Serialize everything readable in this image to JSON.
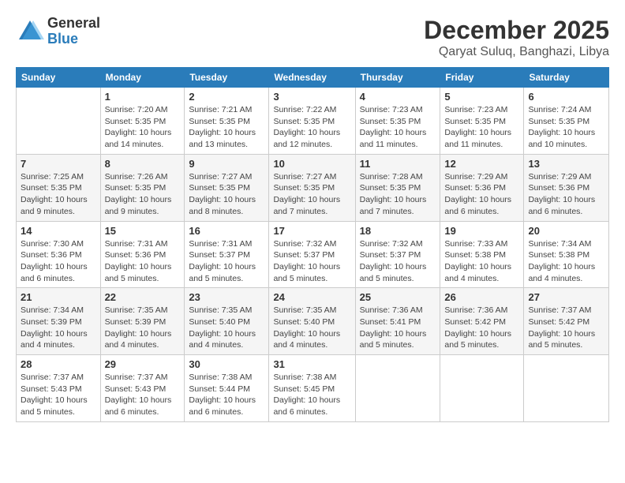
{
  "header": {
    "logo": {
      "general": "General",
      "blue": "Blue"
    },
    "title": "December 2025",
    "location": "Qaryat Suluq, Banghazi, Libya"
  },
  "days_of_week": [
    "Sunday",
    "Monday",
    "Tuesday",
    "Wednesday",
    "Thursday",
    "Friday",
    "Saturday"
  ],
  "weeks": [
    [
      {
        "day": "",
        "sunrise": "",
        "sunset": "",
        "daylight": ""
      },
      {
        "day": "1",
        "sunrise": "Sunrise: 7:20 AM",
        "sunset": "Sunset: 5:35 PM",
        "daylight": "Daylight: 10 hours and 14 minutes."
      },
      {
        "day": "2",
        "sunrise": "Sunrise: 7:21 AM",
        "sunset": "Sunset: 5:35 PM",
        "daylight": "Daylight: 10 hours and 13 minutes."
      },
      {
        "day": "3",
        "sunrise": "Sunrise: 7:22 AM",
        "sunset": "Sunset: 5:35 PM",
        "daylight": "Daylight: 10 hours and 12 minutes."
      },
      {
        "day": "4",
        "sunrise": "Sunrise: 7:23 AM",
        "sunset": "Sunset: 5:35 PM",
        "daylight": "Daylight: 10 hours and 11 minutes."
      },
      {
        "day": "5",
        "sunrise": "Sunrise: 7:23 AM",
        "sunset": "Sunset: 5:35 PM",
        "daylight": "Daylight: 10 hours and 11 minutes."
      },
      {
        "day": "6",
        "sunrise": "Sunrise: 7:24 AM",
        "sunset": "Sunset: 5:35 PM",
        "daylight": "Daylight: 10 hours and 10 minutes."
      }
    ],
    [
      {
        "day": "7",
        "sunrise": "Sunrise: 7:25 AM",
        "sunset": "Sunset: 5:35 PM",
        "daylight": "Daylight: 10 hours and 9 minutes."
      },
      {
        "day": "8",
        "sunrise": "Sunrise: 7:26 AM",
        "sunset": "Sunset: 5:35 PM",
        "daylight": "Daylight: 10 hours and 9 minutes."
      },
      {
        "day": "9",
        "sunrise": "Sunrise: 7:27 AM",
        "sunset": "Sunset: 5:35 PM",
        "daylight": "Daylight: 10 hours and 8 minutes."
      },
      {
        "day": "10",
        "sunrise": "Sunrise: 7:27 AM",
        "sunset": "Sunset: 5:35 PM",
        "daylight": "Daylight: 10 hours and 7 minutes."
      },
      {
        "day": "11",
        "sunrise": "Sunrise: 7:28 AM",
        "sunset": "Sunset: 5:35 PM",
        "daylight": "Daylight: 10 hours and 7 minutes."
      },
      {
        "day": "12",
        "sunrise": "Sunrise: 7:29 AM",
        "sunset": "Sunset: 5:36 PM",
        "daylight": "Daylight: 10 hours and 6 minutes."
      },
      {
        "day": "13",
        "sunrise": "Sunrise: 7:29 AM",
        "sunset": "Sunset: 5:36 PM",
        "daylight": "Daylight: 10 hours and 6 minutes."
      }
    ],
    [
      {
        "day": "14",
        "sunrise": "Sunrise: 7:30 AM",
        "sunset": "Sunset: 5:36 PM",
        "daylight": "Daylight: 10 hours and 6 minutes."
      },
      {
        "day": "15",
        "sunrise": "Sunrise: 7:31 AM",
        "sunset": "Sunset: 5:36 PM",
        "daylight": "Daylight: 10 hours and 5 minutes."
      },
      {
        "day": "16",
        "sunrise": "Sunrise: 7:31 AM",
        "sunset": "Sunset: 5:37 PM",
        "daylight": "Daylight: 10 hours and 5 minutes."
      },
      {
        "day": "17",
        "sunrise": "Sunrise: 7:32 AM",
        "sunset": "Sunset: 5:37 PM",
        "daylight": "Daylight: 10 hours and 5 minutes."
      },
      {
        "day": "18",
        "sunrise": "Sunrise: 7:32 AM",
        "sunset": "Sunset: 5:37 PM",
        "daylight": "Daylight: 10 hours and 5 minutes."
      },
      {
        "day": "19",
        "sunrise": "Sunrise: 7:33 AM",
        "sunset": "Sunset: 5:38 PM",
        "daylight": "Daylight: 10 hours and 4 minutes."
      },
      {
        "day": "20",
        "sunrise": "Sunrise: 7:34 AM",
        "sunset": "Sunset: 5:38 PM",
        "daylight": "Daylight: 10 hours and 4 minutes."
      }
    ],
    [
      {
        "day": "21",
        "sunrise": "Sunrise: 7:34 AM",
        "sunset": "Sunset: 5:39 PM",
        "daylight": "Daylight: 10 hours and 4 minutes."
      },
      {
        "day": "22",
        "sunrise": "Sunrise: 7:35 AM",
        "sunset": "Sunset: 5:39 PM",
        "daylight": "Daylight: 10 hours and 4 minutes."
      },
      {
        "day": "23",
        "sunrise": "Sunrise: 7:35 AM",
        "sunset": "Sunset: 5:40 PM",
        "daylight": "Daylight: 10 hours and 4 minutes."
      },
      {
        "day": "24",
        "sunrise": "Sunrise: 7:35 AM",
        "sunset": "Sunset: 5:40 PM",
        "daylight": "Daylight: 10 hours and 4 minutes."
      },
      {
        "day": "25",
        "sunrise": "Sunrise: 7:36 AM",
        "sunset": "Sunset: 5:41 PM",
        "daylight": "Daylight: 10 hours and 5 minutes."
      },
      {
        "day": "26",
        "sunrise": "Sunrise: 7:36 AM",
        "sunset": "Sunset: 5:42 PM",
        "daylight": "Daylight: 10 hours and 5 minutes."
      },
      {
        "day": "27",
        "sunrise": "Sunrise: 7:37 AM",
        "sunset": "Sunset: 5:42 PM",
        "daylight": "Daylight: 10 hours and 5 minutes."
      }
    ],
    [
      {
        "day": "28",
        "sunrise": "Sunrise: 7:37 AM",
        "sunset": "Sunset: 5:43 PM",
        "daylight": "Daylight: 10 hours and 5 minutes."
      },
      {
        "day": "29",
        "sunrise": "Sunrise: 7:37 AM",
        "sunset": "Sunset: 5:43 PM",
        "daylight": "Daylight: 10 hours and 6 minutes."
      },
      {
        "day": "30",
        "sunrise": "Sunrise: 7:38 AM",
        "sunset": "Sunset: 5:44 PM",
        "daylight": "Daylight: 10 hours and 6 minutes."
      },
      {
        "day": "31",
        "sunrise": "Sunrise: 7:38 AM",
        "sunset": "Sunset: 5:45 PM",
        "daylight": "Daylight: 10 hours and 6 minutes."
      },
      {
        "day": "",
        "sunrise": "",
        "sunset": "",
        "daylight": ""
      },
      {
        "day": "",
        "sunrise": "",
        "sunset": "",
        "daylight": ""
      },
      {
        "day": "",
        "sunrise": "",
        "sunset": "",
        "daylight": ""
      }
    ]
  ]
}
